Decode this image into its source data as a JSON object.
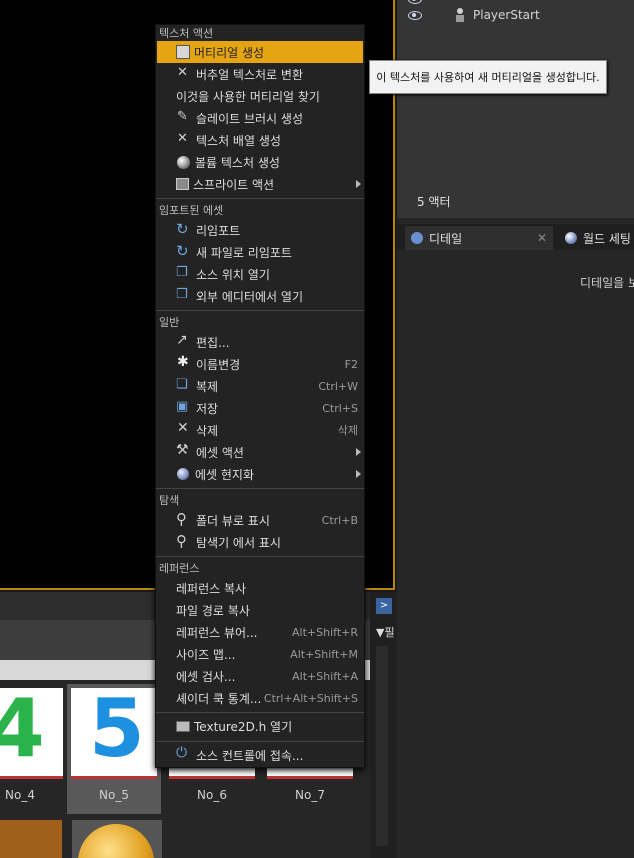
{
  "outliner": {
    "rows": [
      {
        "label": "PlayerStart"
      }
    ],
    "actor_count": "5 액터"
  },
  "details_tabs": {
    "details_label": "디테일",
    "world_label": "월드 세팅",
    "hint": "디테일을 보"
  },
  "content_browser": {
    "tiles": [
      {
        "label": "No_4",
        "digit": "4",
        "digit_color": "#29b34a"
      },
      {
        "label": "No_5",
        "digit": "5",
        "digit_color": "#1e90e0"
      },
      {
        "label": "No_6"
      },
      {
        "label": "No_7"
      }
    ],
    "filter_label": "필"
  },
  "context_menu": {
    "sections": [
      {
        "title": "텍스처 액션",
        "items": [
          {
            "label": "머티리얼 생성",
            "icon": "material-icon"
          },
          {
            "label": "버추얼 텍스처로 변환",
            "icon": "convert-icon"
          },
          {
            "label": "이것을 사용한 머티리얼 찾기",
            "icon": ""
          },
          {
            "label": "슬레이트 브러시 생성",
            "icon": "brush-icon"
          },
          {
            "label": "텍스처 배열 생성",
            "icon": "array-icon"
          },
          {
            "label": "볼륨 텍스처 생성",
            "icon": "sphere-icon"
          },
          {
            "label": "스프라이트 액션",
            "icon": "sprite-icon",
            "submenu": true
          }
        ]
      },
      {
        "title": "임포트된 에셋",
        "items": [
          {
            "label": "리임포트",
            "icon": "reimport-icon"
          },
          {
            "label": "새 파일로 리임포트",
            "icon": "reimport-new-icon"
          },
          {
            "label": "소스 위치 열기",
            "icon": "open-location-icon"
          },
          {
            "label": "외부 에디터에서 열기",
            "icon": "external-editor-icon"
          }
        ]
      },
      {
        "title": "일반",
        "items": [
          {
            "label": "편집...",
            "icon": "edit-icon"
          },
          {
            "label": "이름변경",
            "icon": "rename-icon",
            "shortcut": "F2"
          },
          {
            "label": "복제",
            "icon": "duplicate-icon",
            "shortcut": "Ctrl+W"
          },
          {
            "label": "저장",
            "icon": "save-icon",
            "shortcut": "Ctrl+S"
          },
          {
            "label": "삭제",
            "icon": "delete-icon",
            "shortcut": "삭제"
          },
          {
            "label": "에셋 액션",
            "icon": "wrench-icon",
            "submenu": true
          },
          {
            "label": "에셋 현지화",
            "icon": "globe-icon",
            "submenu": true
          }
        ]
      },
      {
        "title": "탐색",
        "items": [
          {
            "label": "폴더 뷰로 표시",
            "icon": "folder-search-icon",
            "shortcut": "Ctrl+B"
          },
          {
            "label": "탐색기 에서 표시",
            "icon": "explorer-search-icon"
          }
        ]
      },
      {
        "title": "레퍼런스",
        "items": [
          {
            "label": "레퍼런스 복사",
            "icon": ""
          },
          {
            "label": "파일 경로 복사",
            "icon": ""
          },
          {
            "label": "레퍼런스 뷰어...",
            "icon": "",
            "shortcut": "Alt+Shift+R"
          },
          {
            "label": "사이즈 맵...",
            "icon": "",
            "shortcut": "Alt+Shift+M"
          },
          {
            "label": "에셋 검사...",
            "icon": "",
            "shortcut": "Alt+Shift+A"
          },
          {
            "label": "셰이더 쿡 통계...",
            "icon": "",
            "shortcut": "Ctrl+Alt+Shift+S"
          }
        ]
      }
    ],
    "extra": [
      {
        "label": "Texture2D.h 열기",
        "icon": "code-icon"
      },
      {
        "label": "소스 컨트롤에 접속...",
        "icon": "source-control-icon"
      }
    ]
  },
  "tooltip": "이 텍스처를 사용하여 새 머티리얼을 생성합니다."
}
